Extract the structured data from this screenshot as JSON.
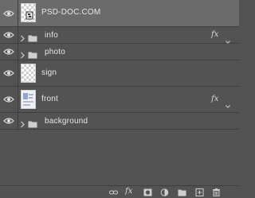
{
  "layers": [
    {
      "name": "PSD-DOC.COM",
      "kind": "text-thumb",
      "selected": true,
      "fx": ""
    },
    {
      "name": "info",
      "kind": "group",
      "selected": false,
      "fx": "fx"
    },
    {
      "name": "photo",
      "kind": "group",
      "selected": false,
      "fx": ""
    },
    {
      "name": "sign",
      "kind": "transparent-thumb",
      "selected": false,
      "fx": ""
    },
    {
      "name": "front",
      "kind": "image-thumb",
      "selected": false,
      "fx": "fx"
    },
    {
      "name": "background",
      "kind": "group",
      "selected": false,
      "fx": ""
    }
  ],
  "footer": {
    "fx_label": "fx",
    "icons": [
      "link-icon",
      "fx-icon",
      "mask-icon",
      "adjustment-icon",
      "group-icon",
      "new-layer-icon",
      "trash-icon"
    ]
  },
  "colors": {
    "panel_bg": "#535353",
    "selected_bg": "#6b6b6b",
    "divider": "#3e3e3e",
    "text": "#e6e6e6"
  }
}
